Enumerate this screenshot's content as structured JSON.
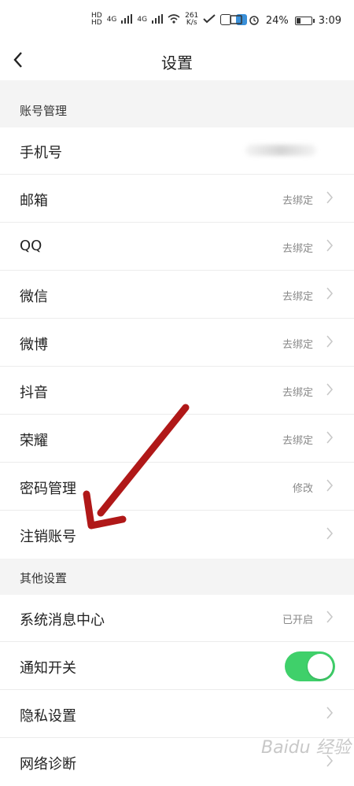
{
  "status_bar": {
    "network_speed": "261",
    "network_speed_unit": "K/s",
    "signal_1": "4G",
    "signal_2": "4G",
    "battery": "24%",
    "time": "3:09"
  },
  "header": {
    "title": "设置"
  },
  "sections": {
    "account": {
      "title": "账号管理",
      "rows": [
        {
          "label": "手机号",
          "value": ""
        },
        {
          "label": "邮箱",
          "value": "去绑定"
        },
        {
          "label": "QQ",
          "value": "去绑定"
        },
        {
          "label": "微信",
          "value": "去绑定"
        },
        {
          "label": "微博",
          "value": "去绑定"
        },
        {
          "label": "抖音",
          "value": "去绑定"
        },
        {
          "label": "荣耀",
          "value": "去绑定"
        },
        {
          "label": "密码管理",
          "value": "修改"
        },
        {
          "label": "注销账号",
          "value": ""
        }
      ]
    },
    "other": {
      "title": "其他设置",
      "rows": [
        {
          "label": "系统消息中心",
          "value": "已开启"
        },
        {
          "label": "通知开关",
          "toggle_on": true
        },
        {
          "label": "隐私设置",
          "value": ""
        },
        {
          "label": "网络诊断",
          "value": ""
        }
      ]
    }
  },
  "overlay": {
    "arrow_color": "#b01818"
  },
  "watermark": "Baidu 经验",
  "colors": {
    "toggle_on": "#3fd06a",
    "section_bg": "#f4f4f4",
    "value_text": "#888888"
  }
}
